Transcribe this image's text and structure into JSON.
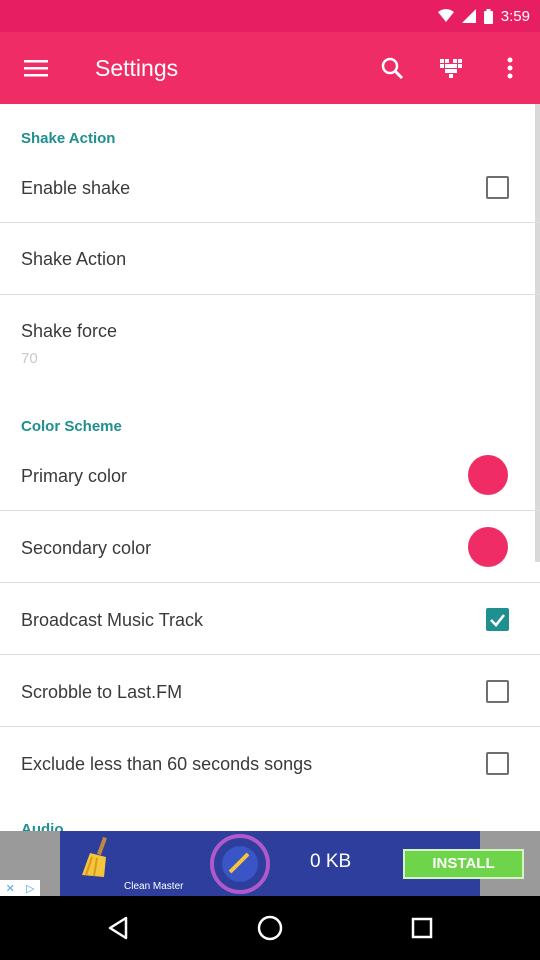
{
  "status_bar": {
    "time": "3:59"
  },
  "app_bar": {
    "title": "Settings",
    "menu_icon": "hamburger-menu-icon",
    "search_icon": "search-icon",
    "heart_icon": "pixel-heart-icon",
    "overflow_icon": "more-vert-icon"
  },
  "sections": {
    "shake": {
      "header": "Shake Action"
    },
    "color": {
      "header": "Color Scheme"
    },
    "audio": {
      "header": "Audio"
    }
  },
  "settings": {
    "enable_shake": {
      "label": "Enable shake",
      "checked": false
    },
    "shake_action": {
      "label": "Shake Action"
    },
    "shake_force": {
      "label": "Shake force",
      "value": "70"
    },
    "primary_color": {
      "label": "Primary color",
      "color": "#f02c67"
    },
    "secondary_color": {
      "label": "Secondary color",
      "color": "#f02c67"
    },
    "broadcast": {
      "label": "Broadcast Music Track",
      "checked": true
    },
    "scrobble": {
      "label": "Scrobble to Last.FM",
      "checked": false
    },
    "exclude_short": {
      "label": "Exclude less than 60 seconds songs",
      "checked": false
    }
  },
  "ad": {
    "app_name": "Clean Master",
    "size": "0 KB",
    "install": "INSTALL"
  },
  "colors": {
    "accent": "#f02c67",
    "status_bar": "#e81e63",
    "section_header": "#1f8f8f"
  }
}
